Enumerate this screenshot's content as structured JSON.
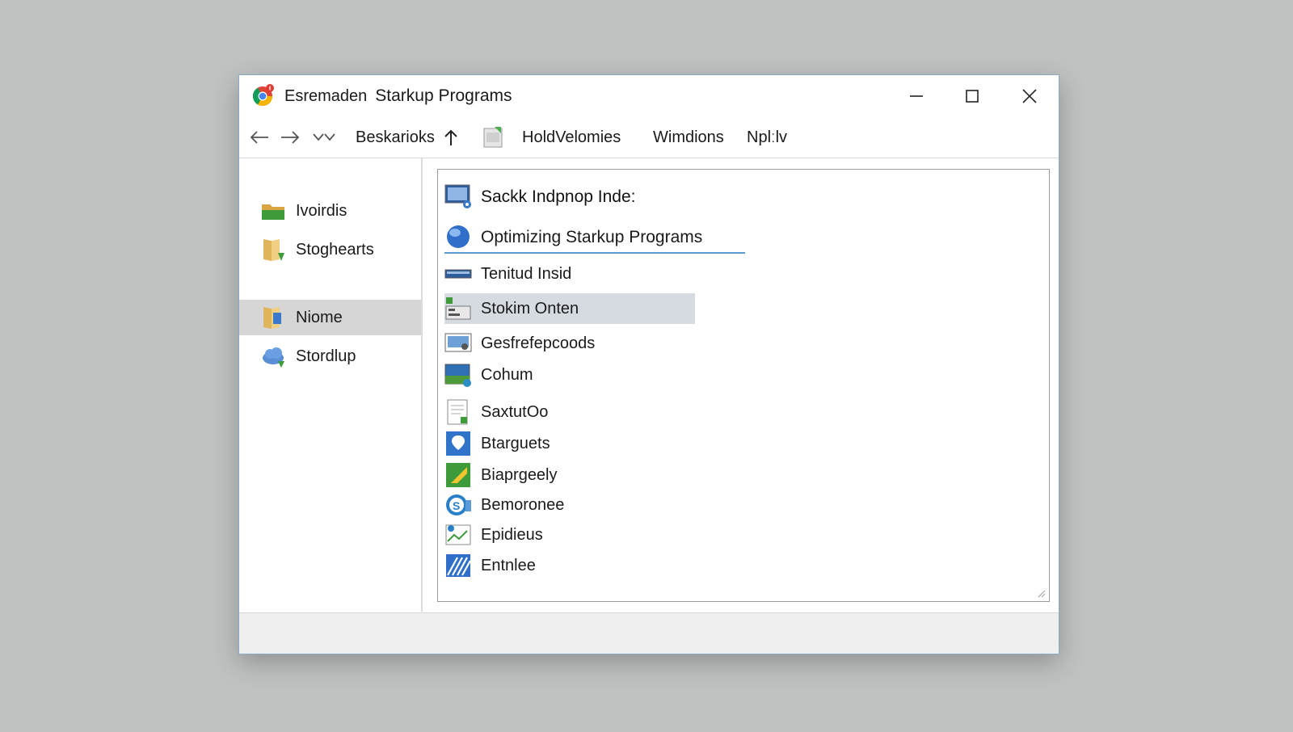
{
  "window": {
    "title_prefix": "Esremaden",
    "title_main": "Starkup Programs"
  },
  "toolbar": {
    "bookmarks": "Beskarioks",
    "holdvelomies": "HoldVelomies",
    "windows": "Wimdions",
    "nplm": "Nplːlv"
  },
  "sidebar": {
    "items": [
      {
        "label": "Ivoirdis",
        "icon": "green-folder-icon"
      },
      {
        "label": "Stoghearts",
        "icon": "folder-shortcut-icon"
      },
      {
        "label": "Niome",
        "icon": "home-folder-icon"
      },
      {
        "label": "Stordlup",
        "icon": "cloud-icon"
      }
    ]
  },
  "content": {
    "header": "Sackk Indpnop Inde:",
    "optimizing": "Optimizing Starkup Programs",
    "items": [
      {
        "label": "Tenitud Insid",
        "icon": "bar-icon"
      },
      {
        "label": "Stokim Onten",
        "icon": "program-list-icon"
      },
      {
        "label": "Gesfrefepcoods",
        "icon": "monitor-settings-icon"
      },
      {
        "label": "Cohum",
        "icon": "landscape-icon"
      },
      {
        "label": "SaxtutOo",
        "icon": "document-icon"
      },
      {
        "label": "Btarguets",
        "icon": "shield-icon"
      },
      {
        "label": "Biaprgeely",
        "icon": "green-app-icon"
      },
      {
        "label": "Bemoronee",
        "icon": "skype-icon"
      },
      {
        "label": "Epidieus",
        "icon": "image-chart-icon"
      },
      {
        "label": "Entnlee",
        "icon": "blue-stripes-icon"
      }
    ]
  }
}
